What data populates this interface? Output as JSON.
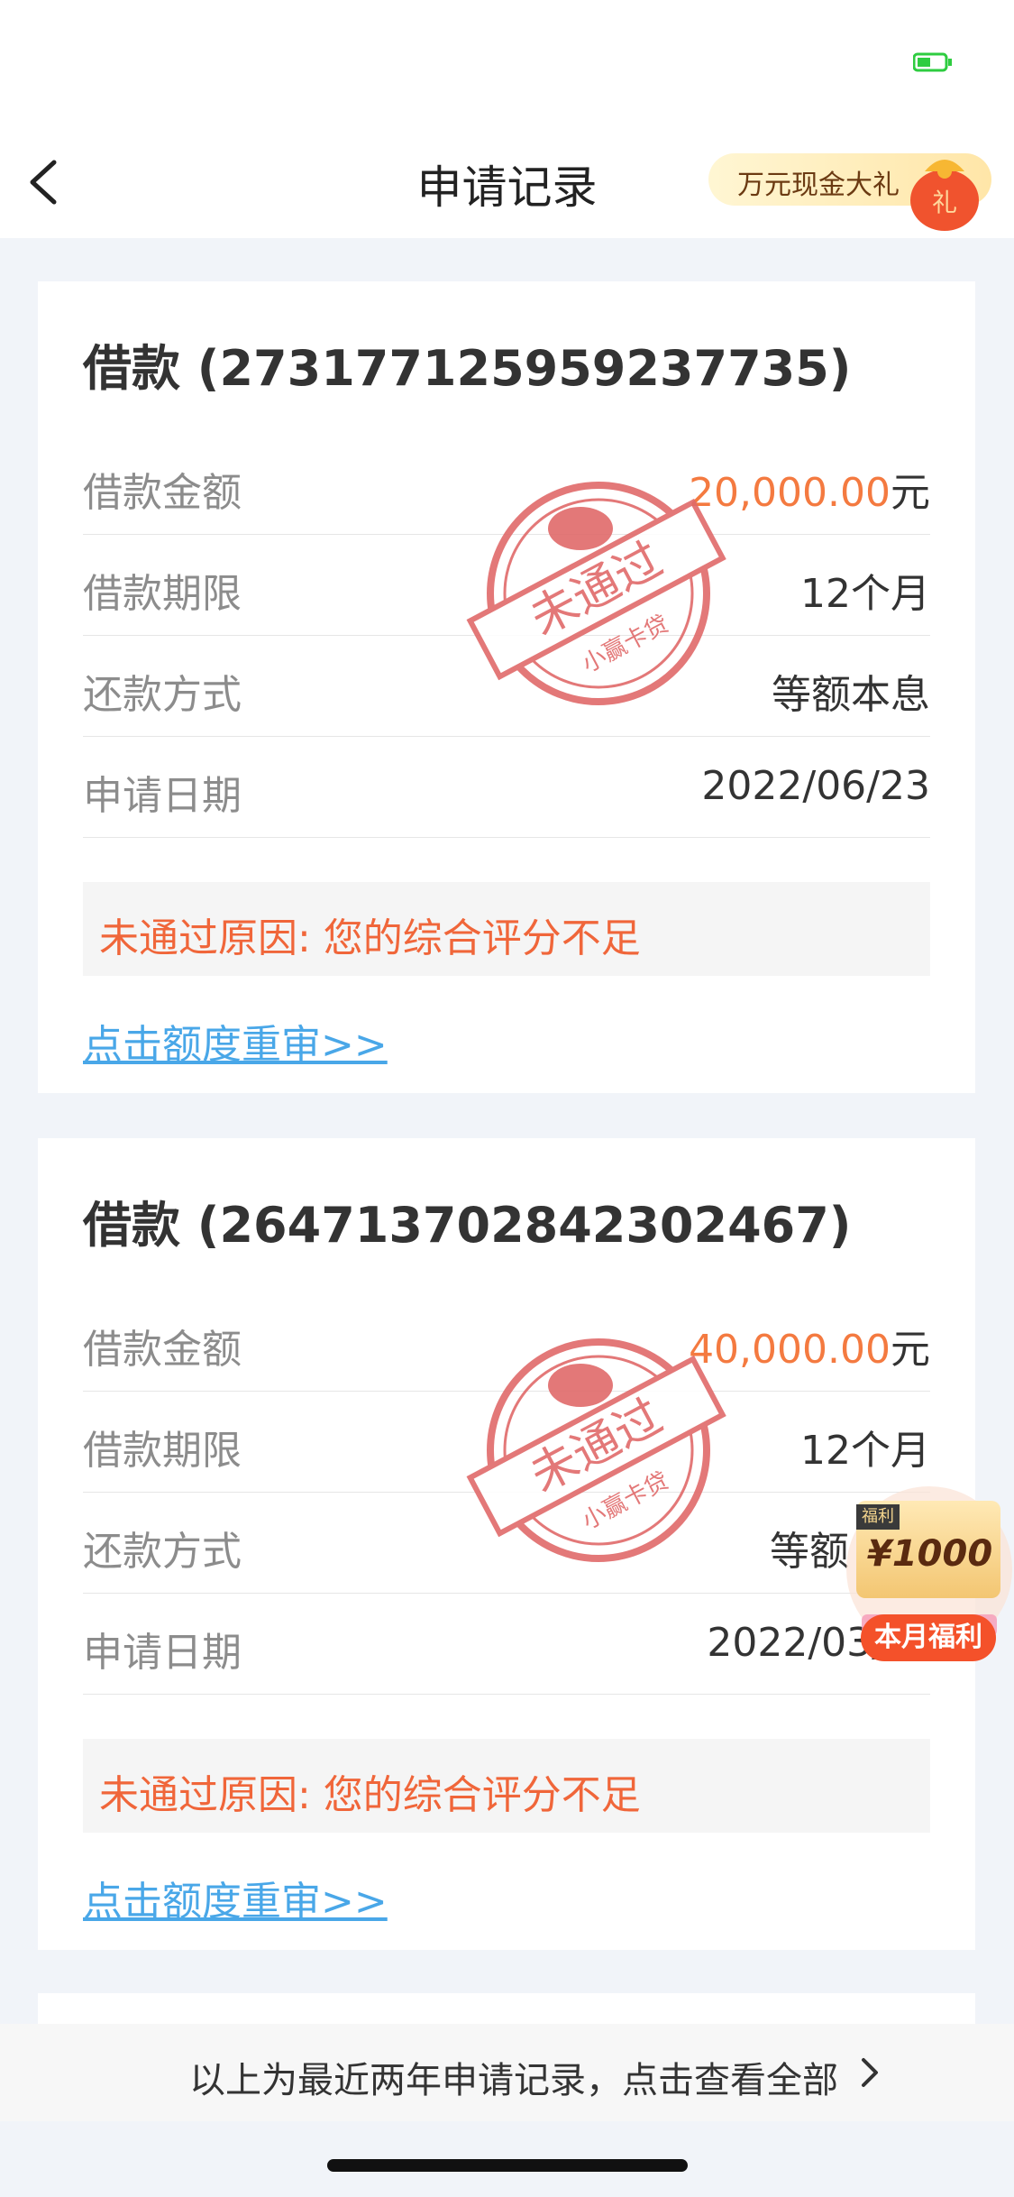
{
  "nav": {
    "title": "申请记录",
    "promo_text": "万元现金大礼",
    "bag_char": "礼"
  },
  "records": [
    {
      "title": "借款 (2731771259592377​35)",
      "rows": [
        {
          "label": "借款金额",
          "value": "20,000.00",
          "unit": "元"
        },
        {
          "label": "借款期限",
          "value": "12个月"
        },
        {
          "label": "还款方式",
          "value": "等额本息"
        },
        {
          "label": "申请日期",
          "value": "2022/06/23"
        }
      ],
      "stamp_text": "未通过",
      "stamp_sub": "小赢卡贷",
      "reason": "未通过原因: 您的综合评分不足",
      "link": "点击额度重审>>"
    },
    {
      "title": "借款 (264713702842302467)",
      "rows": [
        {
          "label": "借款金额",
          "value": "40,000.00",
          "unit": "元"
        },
        {
          "label": "借款期限",
          "value": "12个月"
        },
        {
          "label": "还款方式",
          "value": "等额"
        },
        {
          "label": "申请日期",
          "value": "2022/03/"
        }
      ],
      "stamp_text": "未通过",
      "stamp_sub": "小赢卡贷",
      "reason": "未通过原因: 您的综合评分不足",
      "link": "点击额度重审>>"
    }
  ],
  "floating": {
    "tag": "福利",
    "amount": "¥1000",
    "label": "本月福利"
  },
  "footer": {
    "text": "以上为最近两年申请记录，点击查看全部"
  }
}
